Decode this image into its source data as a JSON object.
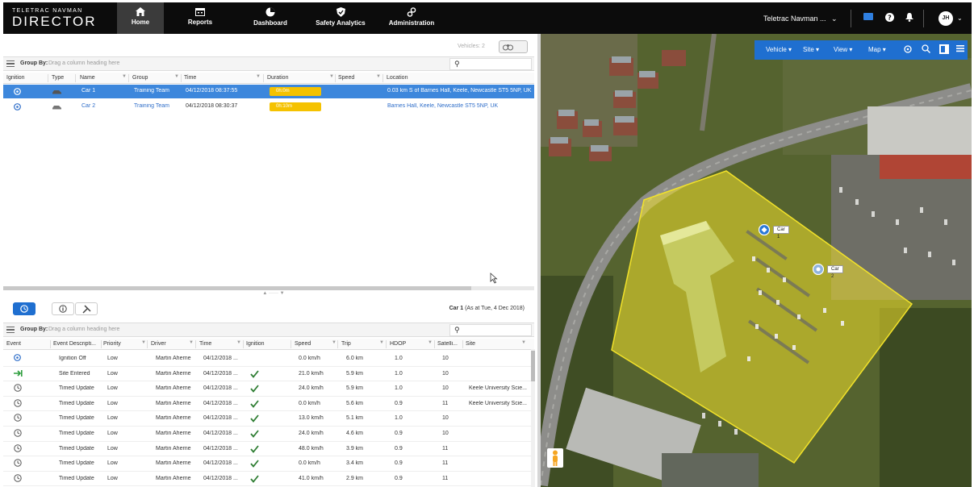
{
  "brand": {
    "line1": "TELETRAC NAVMAN",
    "line2": "DIRECTOR"
  },
  "nav": [
    {
      "label": "Home",
      "icon": "home-icon"
    },
    {
      "label": "Reports",
      "icon": "calendar-icon"
    },
    {
      "label": "Dashboard",
      "icon": "pie-chart-icon"
    },
    {
      "label": "Safety Analytics",
      "icon": "shield-icon"
    },
    {
      "label": "Administration",
      "icon": "gears-icon"
    }
  ],
  "account": {
    "name": "Teletrac Navman ...",
    "caret": "⌄",
    "avatar": "JH"
  },
  "vehicles": {
    "count_label": "Vehicles: 2",
    "group_by_label": "Group By:",
    "group_by_hint": "Drag a column heading here",
    "columns": [
      "Ignition",
      "Type",
      "Name",
      "Group",
      "Time",
      "Duration",
      "Speed",
      "Location"
    ],
    "rows": [
      {
        "name": "Car 1",
        "group": "Training Team",
        "time": "04/12/2018 08:37:55",
        "duration": "0h:0m",
        "speed": "",
        "location": "0.03 km S of Barnes Hall, Keele, Newcastle ST5 5NP, UK",
        "selected": true
      },
      {
        "name": "Car 2",
        "group": "Training Team",
        "time": "04/12/2018 08:30:37",
        "duration": "0h:10m",
        "speed": "",
        "location": "Barnes Hall, Keele, Newcastle ST5 5NP, UK",
        "selected": false
      }
    ]
  },
  "detail": {
    "vehicle": "Car 1",
    "as_at": "(As at Tue, 4 Dec 2018)",
    "group_by_label": "Group By:",
    "group_by_hint": "Drag a column heading here",
    "columns": [
      "Event",
      "Event Descripti...",
      "Priority",
      "Driver",
      "Time",
      "Ignition",
      "Speed",
      "Trip",
      "HDOP",
      "Satelli...",
      "Site"
    ],
    "rows": [
      {
        "icon": "ignition-icon",
        "desc": "Ignition Off",
        "priority": "Low",
        "driver": "Martin Aherne",
        "time": "04/12/2018 ...",
        "ignition": false,
        "speed": "0.0 km/h",
        "trip": "6.0 km",
        "hdop": "1.0",
        "sats": "10",
        "site": ""
      },
      {
        "icon": "site-enter-icon",
        "desc": "Site Entered",
        "priority": "Low",
        "driver": "Martin Aherne",
        "time": "04/12/2018 ...",
        "ignition": true,
        "speed": "21.0 km/h",
        "trip": "5.9 km",
        "hdop": "1.0",
        "sats": "10",
        "site": ""
      },
      {
        "icon": "clock-icon",
        "desc": "Timed Update",
        "priority": "Low",
        "driver": "Martin Aherne",
        "time": "04/12/2018 ...",
        "ignition": true,
        "speed": "24.0 km/h",
        "trip": "5.9 km",
        "hdop": "1.0",
        "sats": "10",
        "site": "Keele University Scie..."
      },
      {
        "icon": "clock-icon",
        "desc": "Timed Update",
        "priority": "Low",
        "driver": "Martin Aherne",
        "time": "04/12/2018 ...",
        "ignition": true,
        "speed": "0.0 km/h",
        "trip": "5.6 km",
        "hdop": "0.9",
        "sats": "11",
        "site": "Keele University Scie..."
      },
      {
        "icon": "clock-icon",
        "desc": "Timed Update",
        "priority": "Low",
        "driver": "Martin Aherne",
        "time": "04/12/2018 ...",
        "ignition": true,
        "speed": "13.0 km/h",
        "trip": "5.1 km",
        "hdop": "1.0",
        "sats": "10",
        "site": ""
      },
      {
        "icon": "clock-icon",
        "desc": "Timed Update",
        "priority": "Low",
        "driver": "Martin Aherne",
        "time": "04/12/2018 ...",
        "ignition": true,
        "speed": "24.0 km/h",
        "trip": "4.6 km",
        "hdop": "0.9",
        "sats": "10",
        "site": ""
      },
      {
        "icon": "clock-icon",
        "desc": "Timed Update",
        "priority": "Low",
        "driver": "Martin Aherne",
        "time": "04/12/2018 ...",
        "ignition": true,
        "speed": "48.0 km/h",
        "trip": "3.9 km",
        "hdop": "0.9",
        "sats": "11",
        "site": ""
      },
      {
        "icon": "clock-icon",
        "desc": "Timed Update",
        "priority": "Low",
        "driver": "Martin Aherne",
        "time": "04/12/2018 ...",
        "ignition": true,
        "speed": "0.0 km/h",
        "trip": "3.4 km",
        "hdop": "0.9",
        "sats": "11",
        "site": ""
      },
      {
        "icon": "clock-icon",
        "desc": "Timed Update",
        "priority": "Low",
        "driver": "Martin Aherne",
        "time": "04/12/2018 ...",
        "ignition": true,
        "speed": "41.0 km/h",
        "trip": "2.9 km",
        "hdop": "0.9",
        "sats": "11",
        "site": ""
      }
    ]
  },
  "map": {
    "toolbar": [
      "Vehicle ▾",
      "Site ▾",
      "View ▾",
      "Map ▾"
    ],
    "markers": [
      "Car 1",
      "Car 2"
    ]
  },
  "colors": {
    "topbar": "#0c0c0c",
    "accent": "#1f6fd0",
    "selected_row": "#3d87dc",
    "duration_badge": "#f5c200",
    "geofence": "#f2e22a"
  }
}
